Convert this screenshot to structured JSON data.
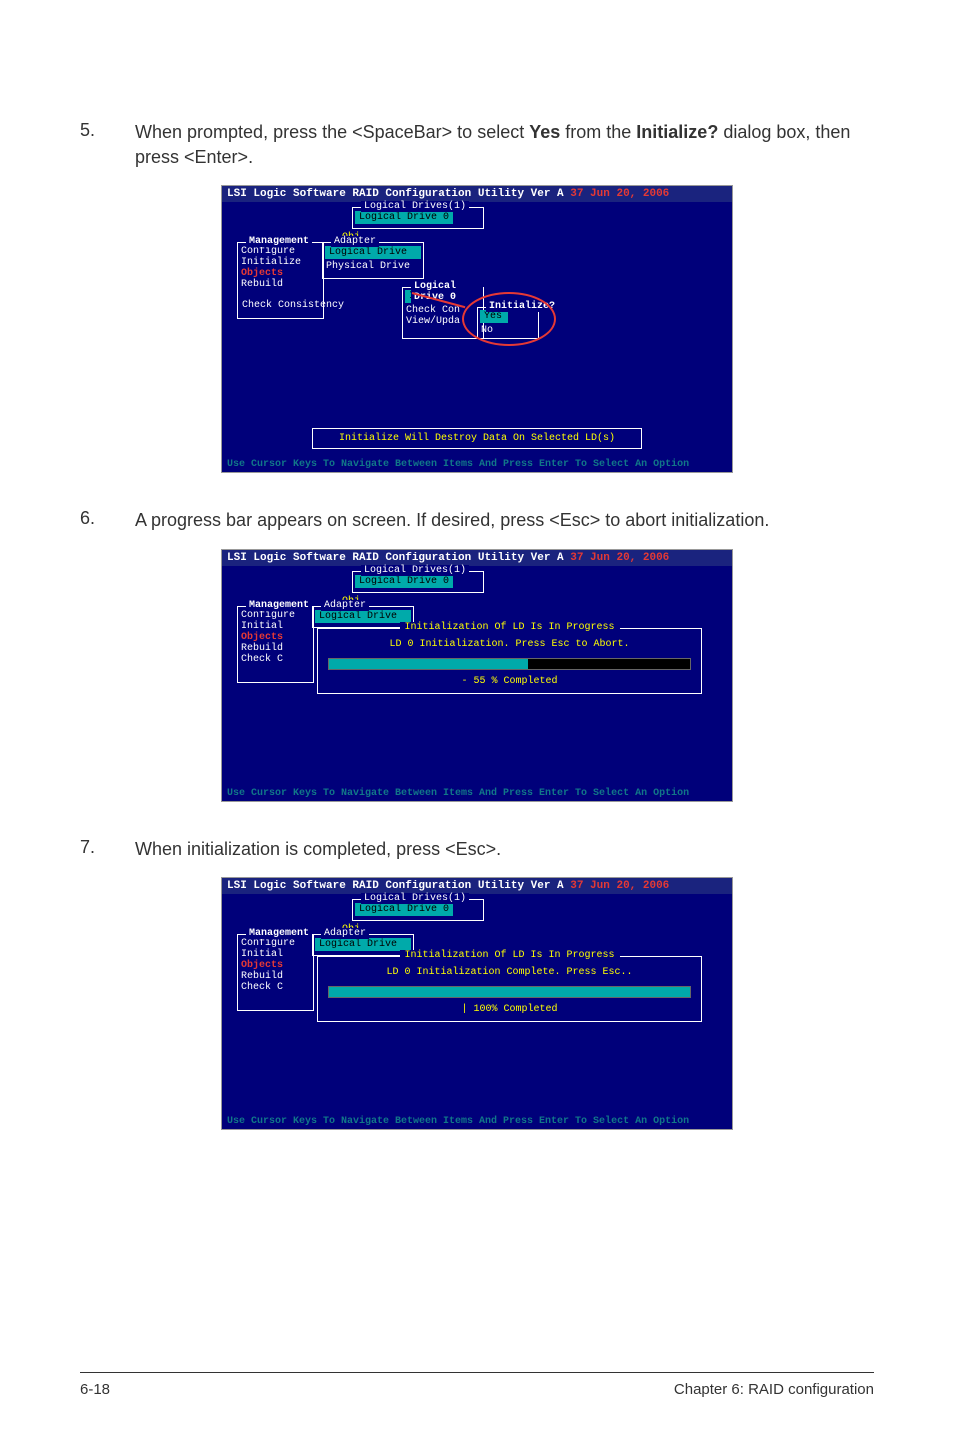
{
  "steps": {
    "s5": {
      "num": "5.",
      "text1": "When prompted, press the <SpaceBar> to select ",
      "bold1": "Yes",
      "text2": " from the ",
      "bold2": "Initialize?",
      "text3": " dialog box, then press <Enter>."
    },
    "s6": {
      "num": "6.",
      "text1": "A progress bar appears on screen. If desired, press <Esc> to abort initialization."
    },
    "s7": {
      "num": "7.",
      "text1": "When initialization is completed, press <Esc>."
    }
  },
  "bios": {
    "title_prefix": "LSI Logic Software RAID Configuration Utility Ver A",
    "title_ver": " 37 Jun 20, 2006",
    "footer": "Use Cursor Keys To Navigate Between Items And Press Enter To Select An Option",
    "logical_drives_box": "Logical Drives(1)",
    "logical_drive_0": "Logical Drive 0",
    "obj": "Obj",
    "management": "Management",
    "adapter": "Adapter",
    "configure": "Configure",
    "logical_drive": "Logical Drive",
    "initialize": "Initialize",
    "physical_drive": "Physical Drive",
    "objects": "Objects",
    "rebuild": "Rebuild",
    "check_consistency": "Check Consistency",
    "initial": "Initial",
    "check_c": "Check C",
    "ld0_box": "Logical Drive 0",
    "init_menu": "Initialize",
    "check_con": "Check Con",
    "view_upda": "View/Upda",
    "init_q": "Initialize?",
    "yes": "Yes",
    "no": "No",
    "destroy_msg": "Initialize Will Destroy Data On Selected LD(s)",
    "prog_title": "Initialization Of LD Is In Progress",
    "prog_abort": "LD 0 Initialization. Press Esc to Abort.",
    "prog_55": "- 55 % Completed",
    "prog_complete": "LD 0 Initialization Complete. Press Esc..",
    "prog_100": "| 100% Completed"
  },
  "footer": {
    "left": "6-18",
    "right": "Chapter 6: RAID configuration"
  }
}
